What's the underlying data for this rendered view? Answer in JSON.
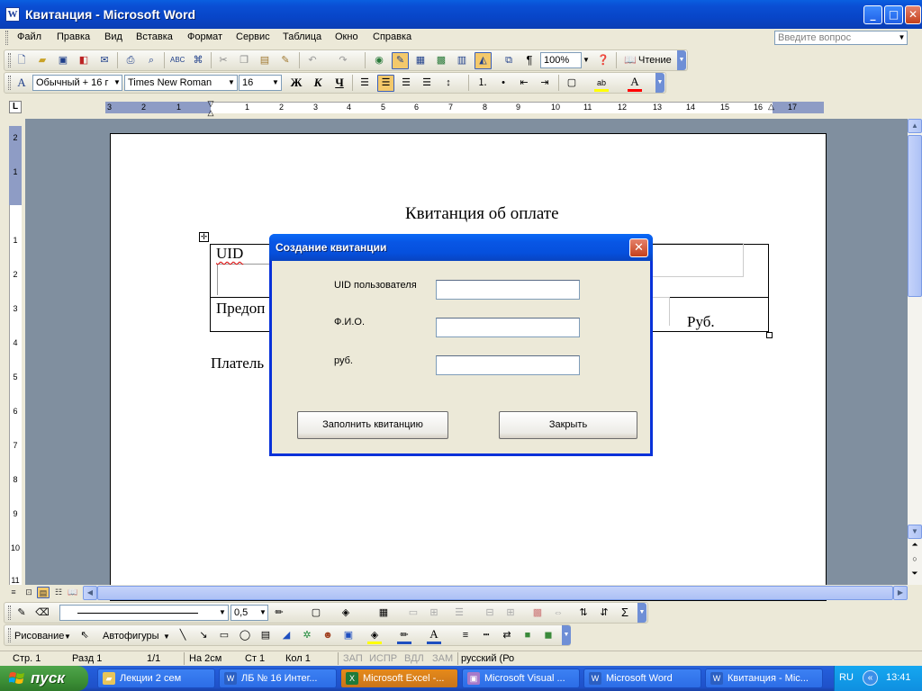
{
  "window": {
    "title": "Квитанция - Microsoft Word",
    "app_icon": "W",
    "controls": {
      "minimize": "_",
      "maximize": "□",
      "close": "✕"
    }
  },
  "menu": {
    "items": [
      "Файл",
      "Правка",
      "Вид",
      "Вставка",
      "Формат",
      "Сервис",
      "Таблица",
      "Окно",
      "Справка"
    ],
    "help_placeholder": "Введите вопрос"
  },
  "toolbar_standard": {
    "zoom": "100%",
    "read_label": "Чтение",
    "pilcrow": "¶"
  },
  "toolbar_format": {
    "style": "Обычный + 16 г",
    "font": "Times New Roman",
    "size": "16",
    "bold": "Ж",
    "italic": "К",
    "underline": "Ч"
  },
  "ruler": {
    "h_labels": [
      "3",
      "2",
      "1",
      "1",
      "2",
      "3",
      "4",
      "5",
      "6",
      "7",
      "8",
      "9",
      "10",
      "11",
      "12",
      "13",
      "14",
      "15",
      "16",
      "17"
    ],
    "v_labels": [
      "2",
      "1",
      "1",
      "2",
      "3",
      "4",
      "5",
      "6",
      "7",
      "8",
      "9",
      "10",
      "11"
    ]
  },
  "document": {
    "title": "Квитанция об оплате",
    "cell_uid": "UID",
    "cell_predop": "Предоп",
    "cell_rub": "Руб.",
    "payer": "Платель",
    "table_handle": "✛"
  },
  "dialog": {
    "title": "Создание квитанции",
    "close": "✕",
    "fields": [
      {
        "label": "UID пользователя",
        "value": ""
      },
      {
        "label": "Ф.И.О.",
        "value": ""
      },
      {
        "label": "руб.",
        "value": ""
      }
    ],
    "fill_button": "Заполнить квитанцию",
    "close_button": "Закрыть"
  },
  "drawing_toolbar": {
    "draw_label": "Рисование",
    "autoshapes_label": "Автофигуры",
    "line_width": "0,5"
  },
  "statusbar": {
    "page": "Стр. 1",
    "section": "Разд 1",
    "pages": "1/1",
    "at": "На 2см",
    "line": "Ст 1",
    "col": "Кол 1",
    "rec": "ЗАП",
    "trk": "ИСПР",
    "ext": "ВДЛ",
    "ovr": "ЗАМ",
    "lang": "русский (Ро"
  },
  "taskbar": {
    "start": "пуск",
    "tasks": [
      {
        "label": "Лекции 2 сем",
        "icon": "folder-icon",
        "color": "#e8c55a"
      },
      {
        "label": "ЛБ № 16 Интег...",
        "icon": "word-icon",
        "color": "#2b5fc2"
      },
      {
        "label": "Microsoft Excel -...",
        "icon": "excel-icon",
        "color": "#1f7a3a"
      },
      {
        "label": "Microsoft Visual ...",
        "icon": "vb-icon",
        "color": "#a77ac9"
      },
      {
        "label": "Microsoft Word",
        "icon": "word-icon",
        "color": "#2b5fc2"
      },
      {
        "label": "Квитанция - Mic...",
        "icon": "word-icon",
        "color": "#2b5fc2"
      }
    ],
    "lang": "RU",
    "time": "13:41"
  },
  "colors": {
    "xp_blue": "#0a5fe0",
    "excel_task_active": "#e68a1a",
    "taskbar": "#245edb",
    "start_green": "#3c8f36"
  }
}
